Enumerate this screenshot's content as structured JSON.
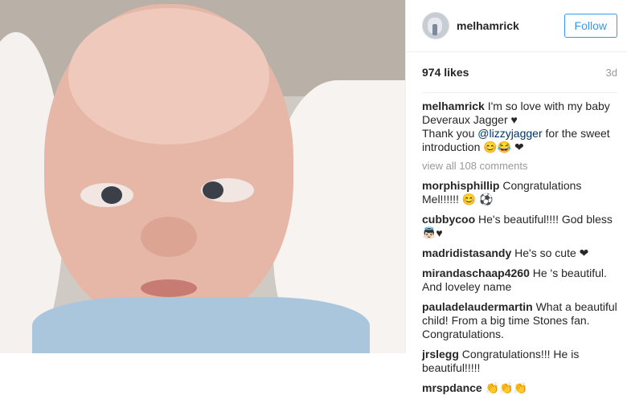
{
  "header": {
    "username": "melhamrick",
    "follow_label": "Follow"
  },
  "stats": {
    "likes": "974 likes",
    "timestamp": "3d"
  },
  "caption": {
    "username": "melhamrick",
    "text1": "I'm so love with my baby Deveraux Jagger ♥",
    "text2_pre": "Thank you ",
    "mention": "@lizzyjagger",
    "text2_post": " for the sweet introduction 😊😂 ❤"
  },
  "view_all": "view all 108 comments",
  "comments": [
    {
      "user": "morphisphillip",
      "text": "Congratulations Mel!!!!!! 😊 ⚽"
    },
    {
      "user": "cubbycoo",
      "text": "He's beautiful!!!! God bless 👼🏻♥"
    },
    {
      "user": "madridistasandy",
      "text": "He's so cute ❤"
    },
    {
      "user": "mirandaschaap4260",
      "text": "He 's beautiful. And loveley name"
    },
    {
      "user": "pauladelaudermartin",
      "text": "What a beautiful child! From a big time Stones fan. Congratulations."
    },
    {
      "user": "jrslegg",
      "text": "Congratulations!!! He is beautiful!!!!!"
    },
    {
      "user": "mrspdance",
      "text": "👏👏👏"
    }
  ],
  "icons": {
    "avatar": "user-avatar"
  }
}
